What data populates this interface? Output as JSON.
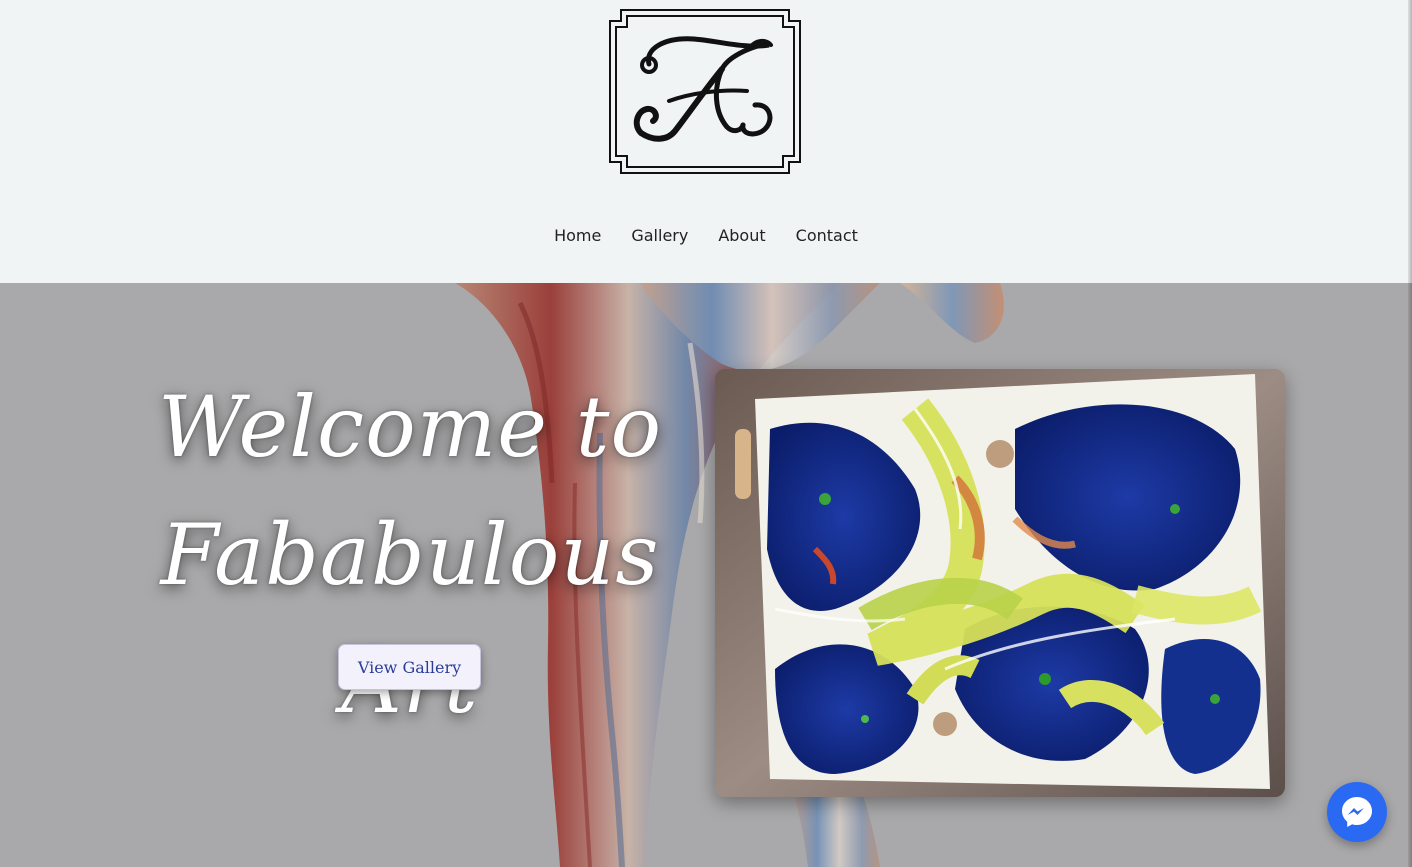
{
  "logo": {
    "icon": "monogram-a-logo",
    "letter": "A"
  },
  "nav": {
    "items": [
      {
        "label": "Home"
      },
      {
        "label": "Gallery"
      },
      {
        "label": "About"
      },
      {
        "label": "Contact"
      }
    ]
  },
  "hero": {
    "title_line1": "Welcome to",
    "title_line2": "Fababulous Art",
    "cta_label": "View Gallery",
    "cta_text_color": "#2a3d9a",
    "background_color": "#a9a9ab"
  },
  "artwork": {
    "icon": "fluid-pour-painting-image"
  },
  "chat": {
    "icon": "messenger-icon",
    "color": "#2a6af3"
  }
}
